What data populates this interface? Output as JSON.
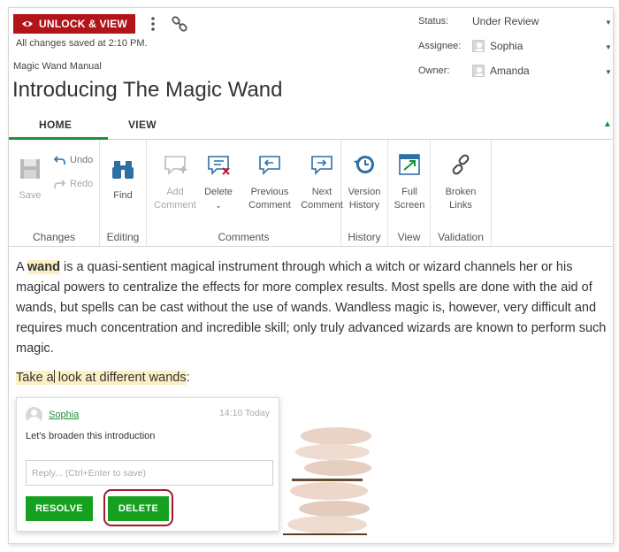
{
  "header": {
    "unlock_button": "UNLOCK & VIEW",
    "saved_status": "All changes saved at 2:10 PM.",
    "doc_category": "Magic Wand Manual",
    "doc_title": "Introducing The Magic Wand"
  },
  "meta": {
    "status_label": "Status:",
    "status_value": "Under Review",
    "assignee_label": "Assignee:",
    "assignee_value": "Sophia",
    "owner_label": "Owner:",
    "owner_value": "Amanda"
  },
  "tabs": [
    {
      "label": "HOME",
      "active": true
    },
    {
      "label": "VIEW",
      "active": false
    }
  ],
  "ribbon": {
    "groups": {
      "changes": "Changes",
      "editing": "Editing",
      "comments": "Comments",
      "history": "History",
      "view": "View",
      "validation": "Validation"
    },
    "buttons": {
      "save": "Save",
      "undo": "Undo",
      "redo": "Redo",
      "find": "Find",
      "add_comment_1": "Add",
      "add_comment_2": "Comment",
      "delete": "Delete",
      "prev_comment_1": "Previous",
      "prev_comment_2": "Comment",
      "next_comment_1": "Next",
      "next_comment_2": "Comment",
      "version_history_1": "Version",
      "version_history_2": "History",
      "full_screen_1": "Full",
      "full_screen_2": "Screen",
      "broken_links_1": "Broken",
      "broken_links_2": "Links"
    }
  },
  "content": {
    "p1_before": "A ",
    "p1_highlight": "wand",
    "p1_after": " is a quasi-sentient magical instrument through which a witch or wizard channels her or his magical powers to centralize the effects for more complex results. Most spells are done with the aid of wands, but spells can be cast without the use of wands. Wandless magic is, however, very difficult and requires much concentration and incredible skill; only truly advanced wizards are known to perform such magic.",
    "p2_highlight_a": "Take a",
    "p2_highlight_b": " look at different wands",
    "p2_after": ":"
  },
  "comment": {
    "author": "Sophia",
    "time": "14:10 Today",
    "text": "Let's broaden this introduction",
    "reply_placeholder": "Reply... (Ctrl+Enter to save)",
    "resolve_label": "RESOLVE",
    "delete_label": "DELETE"
  },
  "colors": {
    "unlock_red": "#b3141a",
    "accent_green": "#1e8f3a",
    "button_green": "#15a01f",
    "highlight_yellow": "#fbefc4",
    "icon_blue": "#2c6fa5"
  }
}
